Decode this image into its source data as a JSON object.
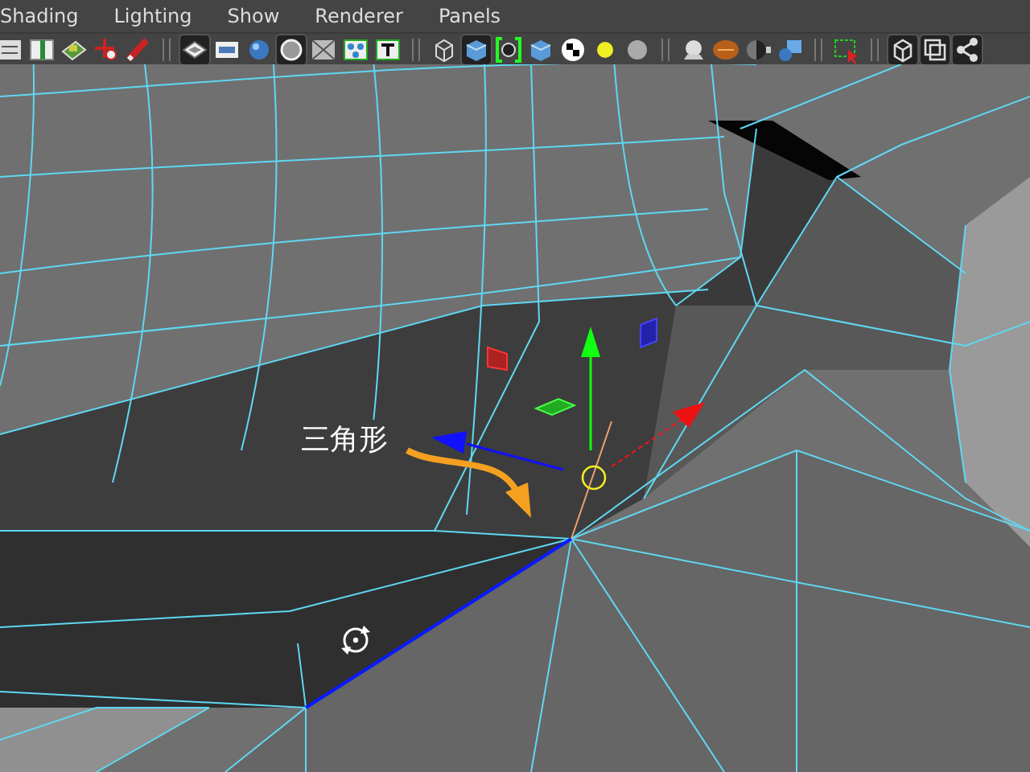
{
  "menu_bar": {
    "items": [
      "Shading",
      "Lighting",
      "Show",
      "Renderer",
      "Panels"
    ]
  },
  "toolbar": [
    {
      "kind": "list",
      "selected": false
    },
    {
      "kind": "book",
      "selected": false
    },
    {
      "kind": "monitor",
      "selected": false
    },
    {
      "kind": "cross",
      "selected": false
    },
    {
      "kind": "pencil",
      "selected": false
    },
    {
      "kind": "sep"
    },
    {
      "kind": "layers",
      "selected": true
    },
    {
      "kind": "film",
      "selected": false
    },
    {
      "kind": "sphere",
      "selected": false
    },
    {
      "kind": "ring",
      "selected": true
    },
    {
      "kind": "mesh",
      "selected": false
    },
    {
      "kind": "nodes",
      "selected": false
    },
    {
      "kind": "text",
      "selected": false
    },
    {
      "kind": "sep"
    },
    {
      "kind": "wirecube",
      "selected": false
    },
    {
      "kind": "cube",
      "selected": true
    },
    {
      "kind": "bracket",
      "selected": false
    },
    {
      "kind": "cube",
      "selected": false
    },
    {
      "kind": "checker",
      "selected": false
    },
    {
      "kind": "light",
      "selected": false
    },
    {
      "kind": "greysphere",
      "selected": false
    },
    {
      "kind": "sep"
    },
    {
      "kind": "bowl",
      "selected": false
    },
    {
      "kind": "ball",
      "selected": false
    },
    {
      "kind": "half",
      "selected": false
    },
    {
      "kind": "cubes",
      "selected": false
    },
    {
      "kind": "sep"
    },
    {
      "kind": "select",
      "selected": false
    },
    {
      "kind": "sep"
    },
    {
      "kind": "frame",
      "selected": true
    },
    {
      "kind": "frames",
      "selected": true
    },
    {
      "kind": "share",
      "selected": true
    }
  ],
  "viewport": {
    "annotation": {
      "label": "三角形"
    }
  }
}
